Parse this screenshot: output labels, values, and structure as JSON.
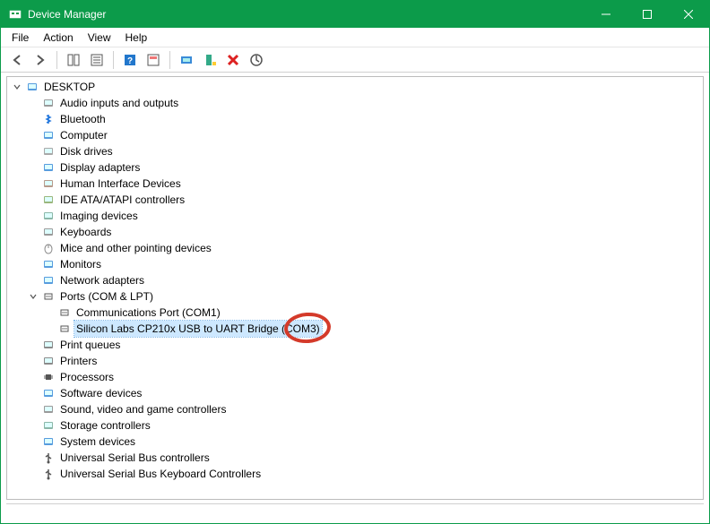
{
  "window": {
    "title": "Device Manager"
  },
  "menubar": {
    "items": [
      "File",
      "Action",
      "View",
      "Help"
    ]
  },
  "toolbar": {
    "items": [
      {
        "name": "back-icon"
      },
      {
        "name": "forward-icon"
      },
      {
        "name": "sep"
      },
      {
        "name": "show-hide-tree-icon"
      },
      {
        "name": "properties-icon"
      },
      {
        "name": "sep"
      },
      {
        "name": "help-icon"
      },
      {
        "name": "action-icon"
      },
      {
        "name": "sep"
      },
      {
        "name": "scan-hardware-icon"
      },
      {
        "name": "add-legacy-icon"
      },
      {
        "name": "uninstall-icon"
      },
      {
        "name": "update-driver-icon"
      }
    ]
  },
  "tree": {
    "root": {
      "label": "DESKTOP",
      "icon": "computer-icon",
      "expanded": true
    },
    "children": [
      {
        "label": "Audio inputs and outputs",
        "icon": "audio-icon",
        "expanded": false
      },
      {
        "label": "Bluetooth",
        "icon": "bluetooth-icon",
        "expanded": false
      },
      {
        "label": "Computer",
        "icon": "computer-icon",
        "expanded": false
      },
      {
        "label": "Disk drives",
        "icon": "disk-icon",
        "expanded": false
      },
      {
        "label": "Display adapters",
        "icon": "display-icon",
        "expanded": false
      },
      {
        "label": "Human Interface Devices",
        "icon": "hid-icon",
        "expanded": false
      },
      {
        "label": "IDE ATA/ATAPI controllers",
        "icon": "ide-icon",
        "expanded": false
      },
      {
        "label": "Imaging devices",
        "icon": "imaging-icon",
        "expanded": false
      },
      {
        "label": "Keyboards",
        "icon": "keyboard-icon",
        "expanded": false
      },
      {
        "label": "Mice and other pointing devices",
        "icon": "mouse-icon",
        "expanded": false
      },
      {
        "label": "Monitors",
        "icon": "monitor-icon",
        "expanded": false
      },
      {
        "label": "Network adapters",
        "icon": "network-icon",
        "expanded": false
      },
      {
        "label": "Ports (COM & LPT)",
        "icon": "port-icon",
        "expanded": true,
        "children": [
          {
            "label": "Communications Port (COM1)",
            "icon": "port-icon"
          },
          {
            "label": "Silicon Labs CP210x USB to UART Bridge (COM3)",
            "icon": "port-icon",
            "selected": true,
            "circled": true
          }
        ]
      },
      {
        "label": "Print queues",
        "icon": "printer-icon",
        "expanded": false
      },
      {
        "label": "Printers",
        "icon": "printer-icon",
        "expanded": false
      },
      {
        "label": "Processors",
        "icon": "cpu-icon",
        "expanded": false
      },
      {
        "label": "Software devices",
        "icon": "software-icon",
        "expanded": false
      },
      {
        "label": "Sound, video and game controllers",
        "icon": "audio-icon",
        "expanded": false
      },
      {
        "label": "Storage controllers",
        "icon": "storage-icon",
        "expanded": false
      },
      {
        "label": "System devices",
        "icon": "system-icon",
        "expanded": false
      },
      {
        "label": "Universal Serial Bus controllers",
        "icon": "usb-icon",
        "expanded": false
      },
      {
        "label": "Universal Serial Bus Keyboard Controllers",
        "icon": "usb-keyboard-icon",
        "expanded": false
      }
    ]
  },
  "annotation": {
    "circle_target": "Silicon Labs CP210x USB to UART Bridge (COM3)",
    "circle_color": "#d43a2a"
  }
}
